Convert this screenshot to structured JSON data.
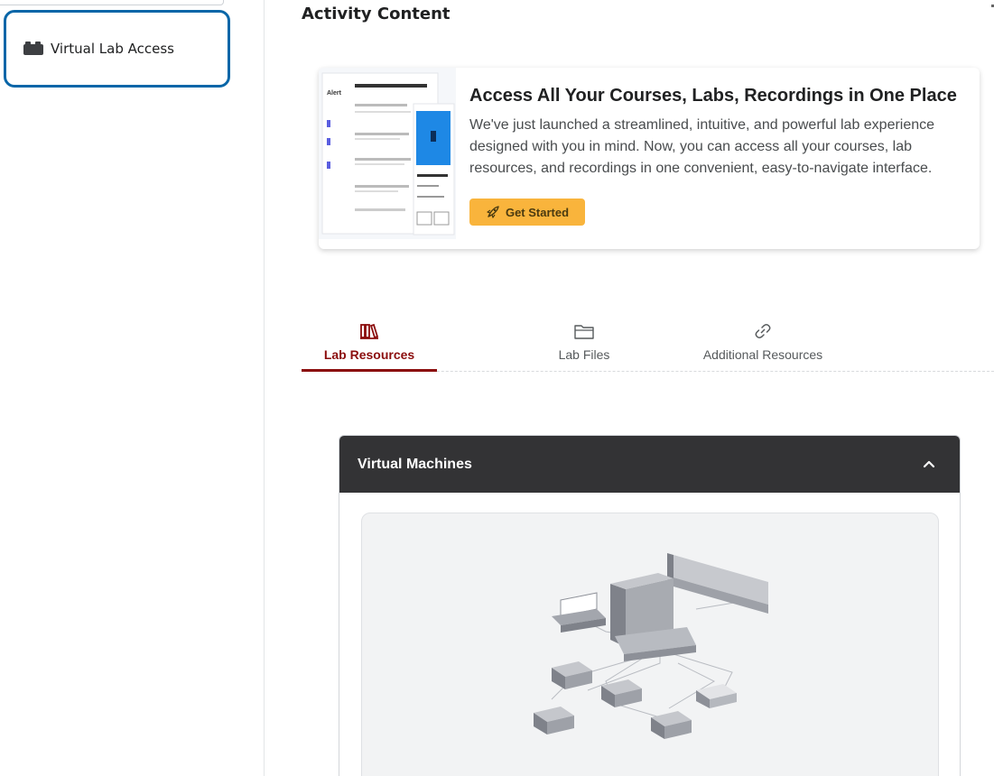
{
  "sidebar": {
    "items": [
      {
        "label": "Virtual Lab Access",
        "icon": "lego-brick-icon"
      }
    ]
  },
  "main": {
    "section_title": "Activity Content",
    "promo": {
      "heading": "Access All Your Courses, Labs, Recordings in One Place",
      "description": "We've just launched a streamlined, intuitive, and powerful lab experience designed with you in mind. Now, you can access all your courses, lab resources, and recordings in one convenient, easy-to-navigate interface.",
      "button_label": "Get Started",
      "button_icon": "rocket-icon",
      "button_color": "#f9b43c"
    },
    "tabs": [
      {
        "label": "Lab Resources",
        "icon": "books-icon",
        "active": true
      },
      {
        "label": "Lab Files",
        "icon": "folder-icon",
        "active": false
      },
      {
        "label": "Additional Resources",
        "icon": "link-icon",
        "active": false
      }
    ],
    "accordion": {
      "title": "Virtual Machines",
      "expanded": true,
      "chevron_icon": "chevron-up-icon"
    }
  },
  "colors": {
    "accent": "#8b0d0d",
    "focus_border": "#0866a8",
    "header_dark": "#333335"
  }
}
